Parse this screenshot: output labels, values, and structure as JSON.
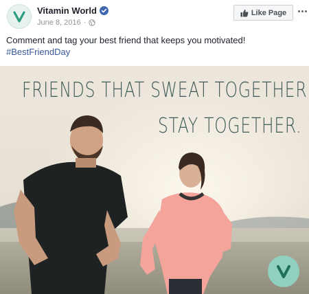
{
  "post": {
    "page_name": "Vitamin World",
    "date": "June 8, 2016",
    "separator": "·",
    "like_button_label": "Like Page",
    "caption": "Comment and tag your best friend that keeps you motivated!",
    "hashtag": "#BestFriendDay"
  },
  "image": {
    "headline_line1": "FRIENDS THAT SWEAT TOGETHER",
    "headline_line2": "STAY TOGETHER."
  },
  "icons": {
    "avatar": "vitamin-world-logo",
    "verified": "verified-badge-icon",
    "privacy": "globe-icon",
    "like": "thumbs-up-icon",
    "more": "more-options-icon"
  },
  "colors": {
    "brand_green": "#2a9d7f",
    "link_blue": "#385898",
    "verified_blue": "#4267b2",
    "headline_text": "#3d5a55"
  }
}
